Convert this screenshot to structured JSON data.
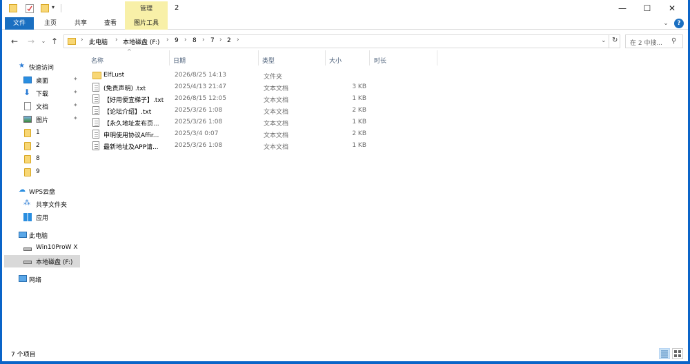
{
  "window": {
    "title": "2",
    "manage_tab": "管理",
    "minimize": "—",
    "maximize": "☐",
    "close": "✕"
  },
  "ribbon": {
    "tabs": [
      "文件",
      "主页",
      "共享",
      "查看",
      "图片工具"
    ],
    "expand": "⌄",
    "help": "?"
  },
  "addressbar": {
    "back": "←",
    "forward": "→",
    "recent": "⌄",
    "up": "↑",
    "crumbs": [
      "此电脑",
      "本地磁盘 (F:)",
      "9",
      "8",
      "7",
      "2"
    ],
    "separator": "›",
    "dropdown": "⌄",
    "refresh": "↻",
    "search_placeholder": "在 2 中搜...",
    "search_icon": "⚲"
  },
  "sidebar": {
    "items": [
      {
        "label": "快速访问",
        "icon": "star-icon",
        "pin": false
      },
      {
        "label": "桌面",
        "icon": "desktop-icon",
        "pin": true
      },
      {
        "label": "下载",
        "icon": "download-icon",
        "pin": true
      },
      {
        "label": "文档",
        "icon": "document-icon",
        "pin": true
      },
      {
        "label": "图片",
        "icon": "picture-icon",
        "pin": true
      },
      {
        "label": "1",
        "icon": "folder-icon",
        "pin": false
      },
      {
        "label": "2",
        "icon": "folder-icon",
        "pin": false
      },
      {
        "label": "8",
        "icon": "folder-icon",
        "pin": false
      },
      {
        "label": "9",
        "icon": "folder-icon",
        "pin": false
      },
      {
        "label": "WPS云盘",
        "icon": "cloud-icon",
        "pin": false
      },
      {
        "label": "共享文件夹",
        "icon": "shared-folder-icon",
        "pin": false
      },
      {
        "label": "应用",
        "icon": "apps-icon",
        "pin": false
      },
      {
        "label": "此电脑",
        "icon": "computer-icon",
        "pin": false
      },
      {
        "label": "Win10ProW X",
        "icon": "drive-icon",
        "pin": false
      },
      {
        "label": "本地磁盘 (F:)",
        "icon": "drive-icon",
        "pin": false,
        "selected": true
      },
      {
        "label": "网络",
        "icon": "network-icon",
        "pin": false
      }
    ],
    "pin_glyph": "📌"
  },
  "filelist": {
    "sort_indicator": "^",
    "columns": [
      "名称",
      "日期",
      "类型",
      "大小",
      "时长"
    ],
    "rows": [
      {
        "name": "ElfLust",
        "date": "2026/8/25 14:13",
        "type": "文件夹",
        "size": "",
        "kind": "folder"
      },
      {
        "name": "(免责声明) .txt",
        "date": "2025/4/13 21:47",
        "type": "文本文档",
        "size": "3 KB",
        "kind": "text"
      },
      {
        "name": "【好用便宜梯子】.txt",
        "date": "2026/8/15 12:05",
        "type": "文本文档",
        "size": "1 KB",
        "kind": "text"
      },
      {
        "name": "【论坛介绍】.txt",
        "date": "2025/3/26 1:08",
        "type": "文本文档",
        "size": "2 KB",
        "kind": "text"
      },
      {
        "name": "【永久地址发布页...",
        "date": "2025/3/26 1:08",
        "type": "文本文档",
        "size": "1 KB",
        "kind": "text"
      },
      {
        "name": "申明使用协议Affir...",
        "date": "2025/3/4 0:07",
        "type": "文本文档",
        "size": "2 KB",
        "kind": "text"
      },
      {
        "name": "最新地址及APP请...",
        "date": "2025/3/26 1:08",
        "type": "文本文档",
        "size": "1 KB",
        "kind": "text"
      }
    ]
  },
  "status": {
    "count": "7 个项目"
  }
}
